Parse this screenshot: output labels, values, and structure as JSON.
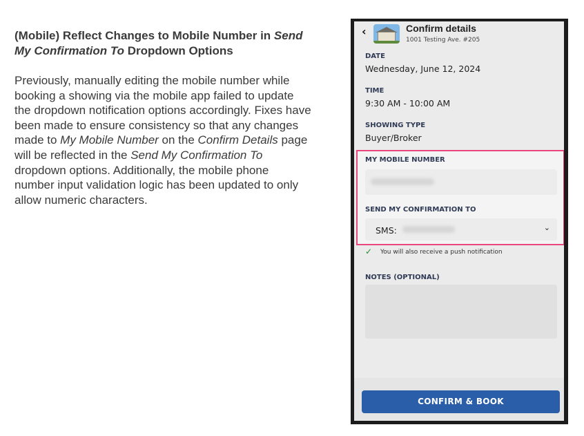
{
  "release_note": {
    "heading_parts": [
      "(Mobile) Reflect Changes to Mobile Number in ",
      "Send My Confirmation To",
      " Dropdown Options"
    ],
    "body_parts": [
      "Previously, manually editing the mobile number while booking a showing via the mobile app failed to update the dropdown notification options accordingly. Fixes have been made to ensure consistency so that any changes made to ",
      "My Mobile Number",
      " on the ",
      "Confirm Details",
      " page will be reflected in the ",
      "Send My Confirmation To",
      " dropdown options. Additionally, the mobile phone number input validation logic has been updated to only allow numeric characters."
    ]
  },
  "app": {
    "header": {
      "back_icon": "chevron-left-icon",
      "back_glyph": "‹",
      "title": "Confirm details",
      "address": "1001 Testing Ave. #205"
    },
    "date": {
      "label": "DATE",
      "value": "Wednesday, June 12, 2024"
    },
    "time": {
      "label": "TIME",
      "value": "9:30 AM - 10:00 AM"
    },
    "showing_type": {
      "label": "SHOWING TYPE",
      "value": "Buyer/Broker"
    },
    "mobile_number": {
      "label": "MY MOBILE NUMBER"
    },
    "send_confirmation": {
      "label": "SEND MY CONFIRMATION TO",
      "selected_prefix": "SMS:",
      "chevron_glyph": "⌄"
    },
    "push_note": {
      "icon": "checkmark-icon",
      "glyph": "✓",
      "text": "You will also receive a push notification"
    },
    "notes": {
      "label": "NOTES (OPTIONAL)"
    },
    "confirm_button": "CONFIRM & BOOK"
  },
  "colors": {
    "highlight_border": "#e8467c",
    "primary_button": "#2a5ea8",
    "success_check": "#1f8f2a",
    "label_text": "#2f3a55"
  }
}
